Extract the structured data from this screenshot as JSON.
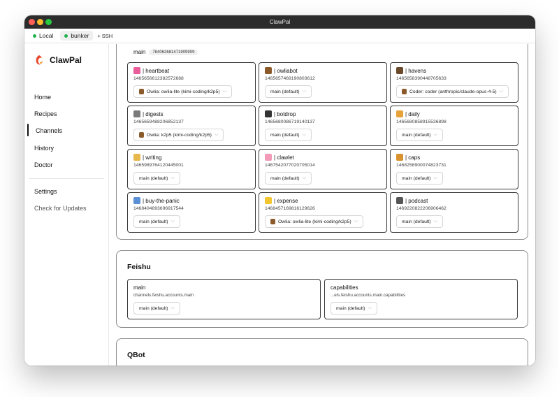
{
  "window": {
    "title": "ClawPal"
  },
  "connections": {
    "tabs": [
      {
        "label": "Local"
      },
      {
        "label": "bunker"
      }
    ],
    "add_ssh": "+ SSH"
  },
  "sidebar": {
    "brand": "ClawPal",
    "items": [
      {
        "label": "Home"
      },
      {
        "label": "Recipes"
      },
      {
        "label": "Channels"
      },
      {
        "label": "History"
      },
      {
        "label": "Doctor"
      },
      {
        "label": "Settings"
      },
      {
        "label": "Check for Updates"
      }
    ]
  },
  "discord": {
    "guild_name": "main",
    "guild_id": "784062681471909909",
    "channels": [
      {
        "name": "| heartbeat",
        "id": "1465656612382572688",
        "agent": "Owlia: owlia-lite (kimi-coding/k2p5)",
        "icon": "heart-icon",
        "color": "#e85d9a"
      },
      {
        "name": "| owliabot",
        "id": "1465657469190803612",
        "agent": "main (default)",
        "icon": "owl-icon",
        "color": "#8b5a2b"
      },
      {
        "name": "| havens",
        "id": "1465658390448705633",
        "agent": "Coder: coder (anthropic/claude-opus-4-5)",
        "icon": "hut-icon",
        "color": "#6b4a2b"
      },
      {
        "name": "| digests",
        "id": "1465659488206852137",
        "agent": "Owlia: k2p5 (kimi-coding/k2p5)",
        "icon": "newspaper-icon",
        "color": "#7a7a7a"
      },
      {
        "name": "| botdrop",
        "id": "1465680086719140137",
        "agent": "main (default)",
        "icon": "phone-icon",
        "color": "#333333"
      },
      {
        "name": "| daily",
        "id": "1465680858915536898",
        "agent": "main (default)",
        "icon": "sparkle-icon",
        "color": "#e8a23a"
      },
      {
        "name": "| writing",
        "id": "1465989764120445001",
        "agent": "main (default)",
        "icon": "pencil-icon",
        "color": "#e8b84a"
      },
      {
        "name": "| clawlet",
        "id": "1467542077020705014",
        "agent": "main (default)",
        "icon": "cake-icon",
        "color": "#f29ab8"
      },
      {
        "name": "| caps",
        "id": "1468258900074823731",
        "agent": "main (default)",
        "icon": "pretzel-icon",
        "color": "#d9932e"
      },
      {
        "name": "| buy-the-panic",
        "id": "1468404893696917544",
        "agent": "main (default)",
        "icon": "chart-down-icon",
        "color": "#5b8fd6"
      },
      {
        "name": "| expense",
        "id": "1468457169816129626",
        "agent": "Owlia: owlia-lite (kimi-coding/k2p5)",
        "icon": "note-icon",
        "color": "#f2c531"
      },
      {
        "name": "| podcast",
        "id": "1469220822206906462",
        "agent": "main (default)",
        "icon": "microphone-icon",
        "color": "#555555"
      }
    ]
  },
  "feishu": {
    "title": "Feishu",
    "accounts": [
      {
        "name": "main",
        "path": "channels.feishu.accounts.main",
        "agent": "main (default)"
      },
      {
        "name": "capabilities",
        "path": "...els.feishu.accounts.main.capabilities",
        "agent": "main (default)"
      }
    ]
  },
  "qbot": {
    "title": "QBot"
  }
}
